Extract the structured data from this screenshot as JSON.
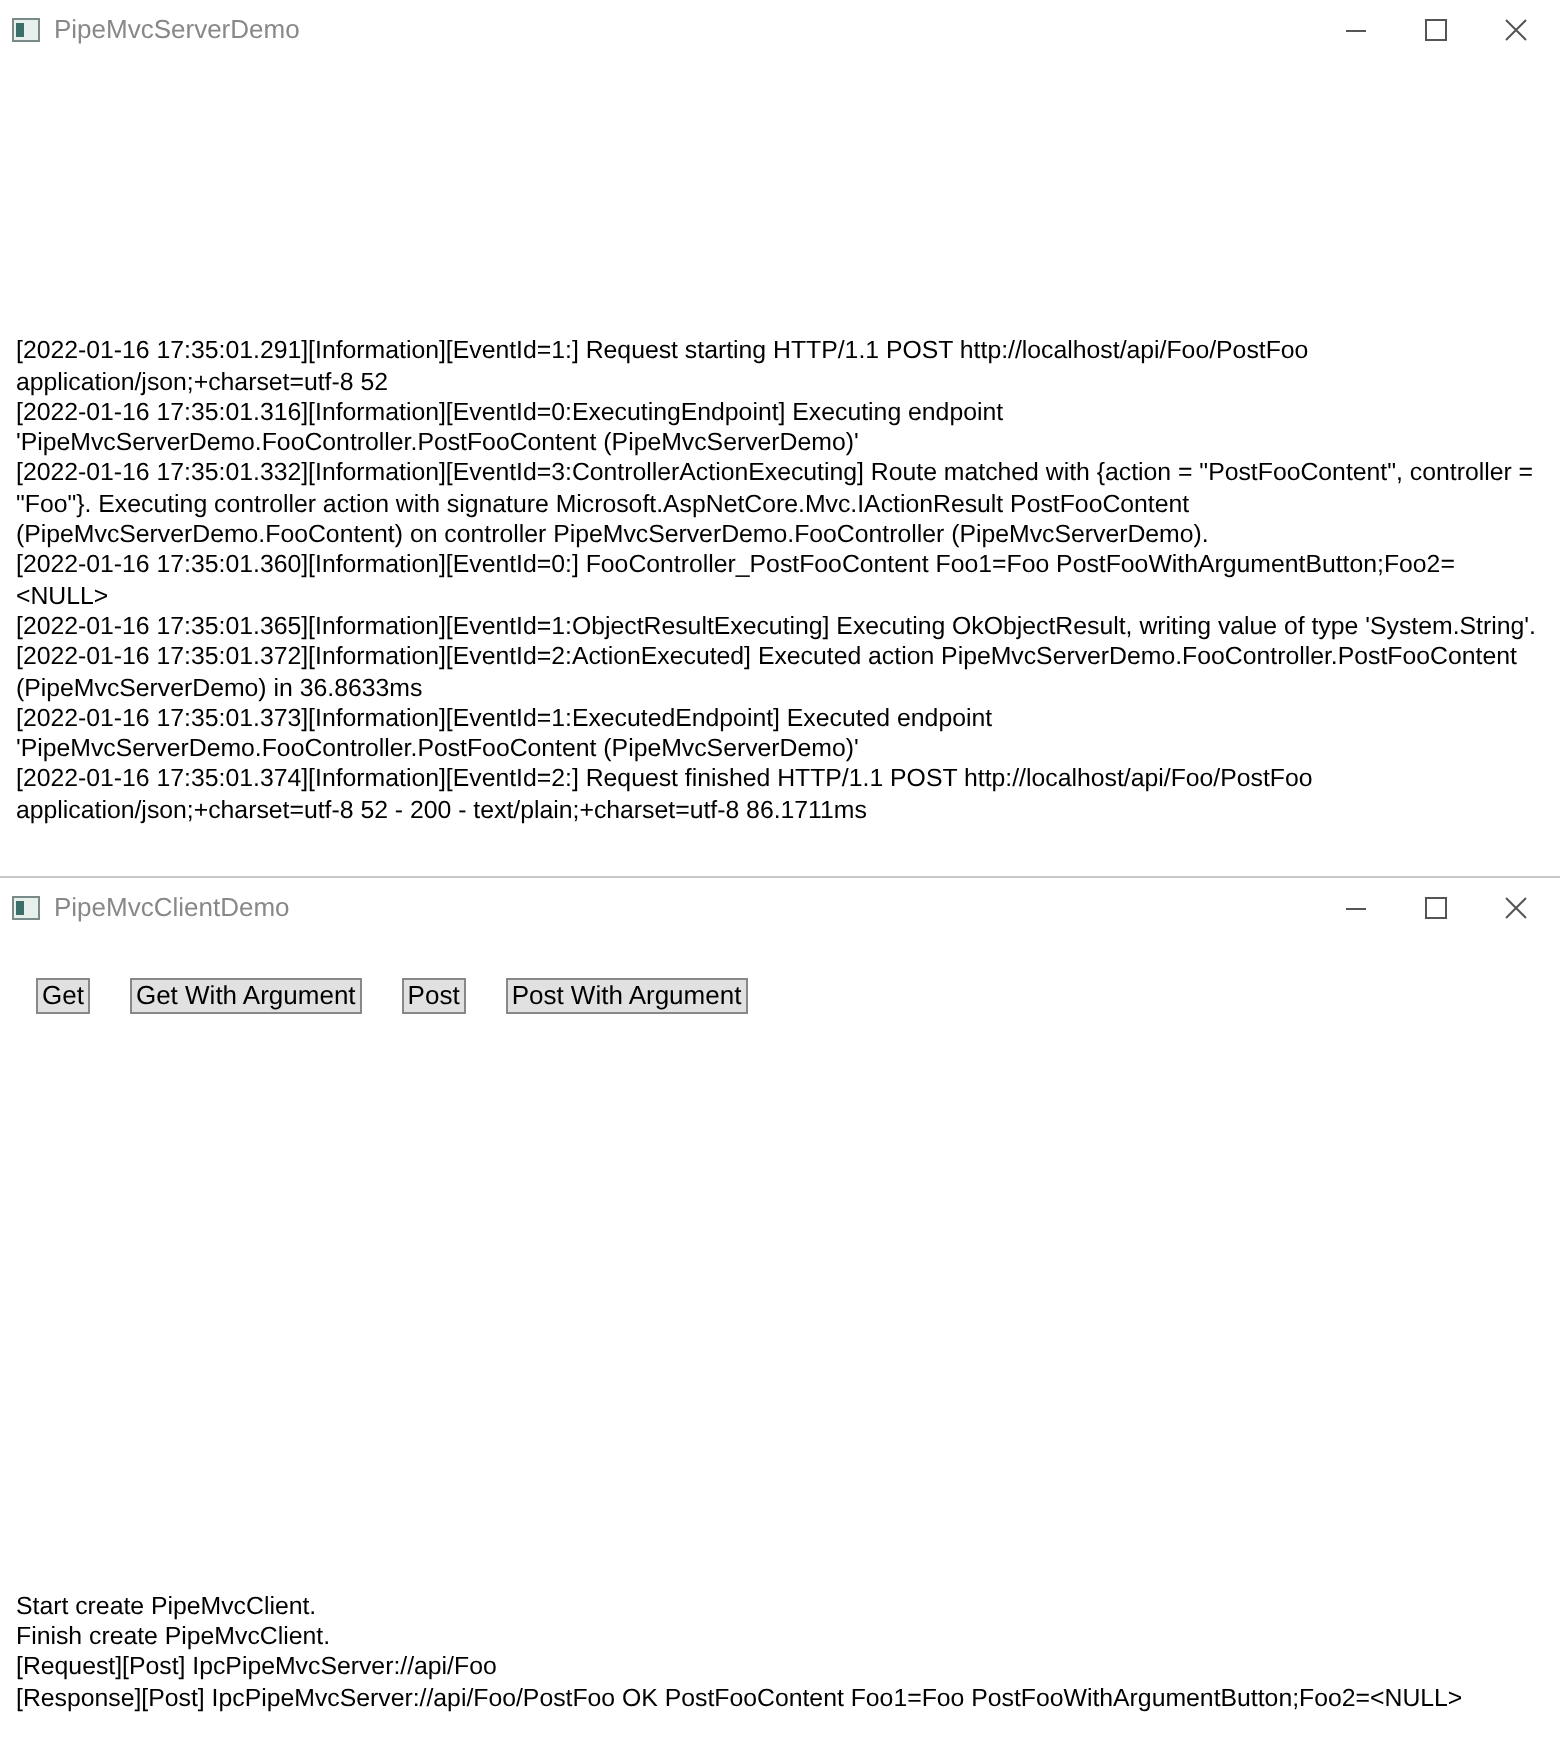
{
  "windows": [
    {
      "title": "PipeMvcServerDemo",
      "log": [
        "[2022-01-16 17:35:01.291][Information][EventId=1:] Request starting HTTP/1.1 POST http://localhost/api/Foo/PostFoo application/json;+charset=utf-8 52",
        "[2022-01-16 17:35:01.316][Information][EventId=0:ExecutingEndpoint] Executing endpoint 'PipeMvcServerDemo.FooController.PostFooContent (PipeMvcServerDemo)'",
        "[2022-01-16 17:35:01.332][Information][EventId=3:ControllerActionExecuting] Route matched with {action = \"PostFooContent\", controller = \"Foo\"}. Executing controller action with signature Microsoft.AspNetCore.Mvc.IActionResult PostFooContent (PipeMvcServerDemo.FooContent) on controller PipeMvcServerDemo.FooController (PipeMvcServerDemo).",
        "[2022-01-16 17:35:01.360][Information][EventId=0:] FooController_PostFooContent Foo1=Foo PostFooWithArgumentButton;Foo2=<NULL>",
        "[2022-01-16 17:35:01.365][Information][EventId=1:ObjectResultExecuting] Executing OkObjectResult, writing value of type 'System.String'.",
        "[2022-01-16 17:35:01.372][Information][EventId=2:ActionExecuted] Executed action PipeMvcServerDemo.FooController.PostFooContent (PipeMvcServerDemo) in 36.8633ms",
        "[2022-01-16 17:35:01.373][Information][EventId=1:ExecutedEndpoint] Executed endpoint 'PipeMvcServerDemo.FooController.PostFooContent (PipeMvcServerDemo)'",
        "[2022-01-16 17:35:01.374][Information][EventId=2:] Request finished HTTP/1.1 POST http://localhost/api/Foo/PostFoo application/json;+charset=utf-8 52 - 200 - text/plain;+charset=utf-8 86.1711ms"
      ]
    },
    {
      "title": "PipeMvcClientDemo",
      "buttons": [
        "Get",
        "Get With Argument",
        "Post",
        "Post With Argument"
      ],
      "log": [
        "Start create PipeMvcClient.",
        "Finish create PipeMvcClient.",
        "[Request][Post] IpcPipeMvcServer://api/Foo",
        "[Response][Post] IpcPipeMvcServer://api/Foo/PostFoo OK PostFooContent Foo1=Foo PostFooWithArgumentButton;Foo2=<NULL>"
      ]
    }
  ]
}
